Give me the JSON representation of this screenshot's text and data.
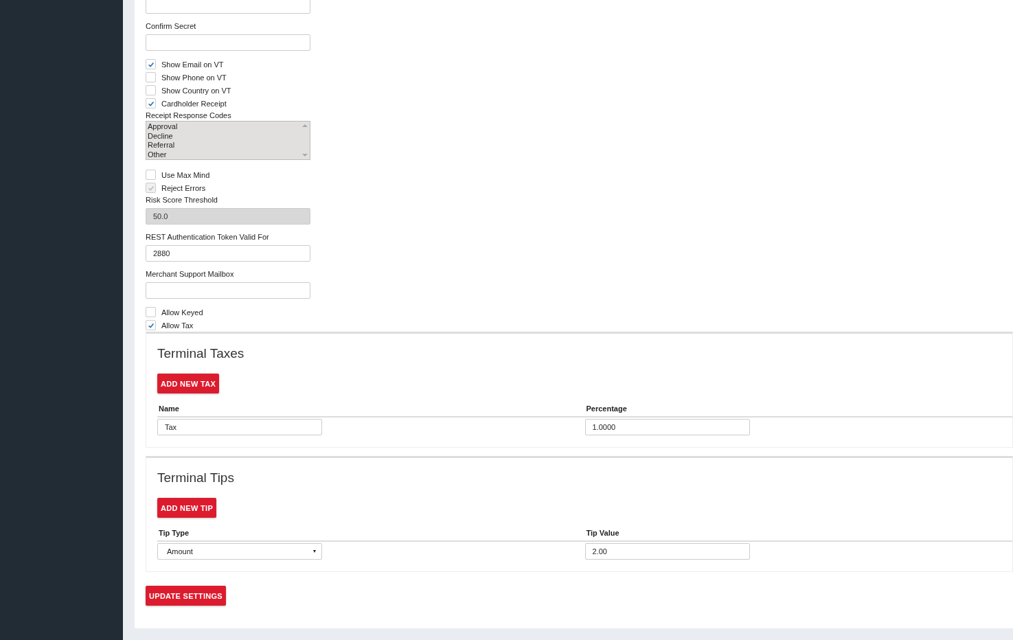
{
  "settings": [
    {
      "kind": "field",
      "disabled": false
    },
    {
      "kind": "field",
      "label": "Confirm Secret",
      "disabled": false
    },
    {
      "kind": "checkbox",
      "label": "Show Email on VT",
      "checked": true,
      "disabled": false
    },
    {
      "kind": "checkbox",
      "label": "Show Phone on VT",
      "checked": false,
      "disabled": false
    },
    {
      "kind": "checkbox",
      "label": "Show Country on VT",
      "checked": false,
      "disabled": false
    },
    {
      "kind": "checkbox",
      "label": "Cardholder Receipt",
      "checked": true,
      "disabled": false
    },
    {
      "kind": "listbox",
      "label": "Receipt Response Codes",
      "options": [
        "Approval",
        "Decline",
        "Referral",
        "Other"
      ]
    },
    {
      "kind": "checkbox",
      "label": "Use Max Mind",
      "checked": false,
      "disabled": false
    },
    {
      "kind": "checkbox",
      "label": "Reject Errors",
      "checked": true,
      "disabled": true
    },
    {
      "kind": "field",
      "label": "Risk Score Threshold",
      "value": "50.0",
      "disabled": true
    },
    {
      "kind": "field",
      "label": "REST Authentication Token Valid For",
      "value": "2880",
      "disabled": false
    },
    {
      "kind": "field",
      "label": "Merchant Support Mailbox",
      "disabled": false
    },
    {
      "kind": "checkbox",
      "label": "Allow Keyed",
      "checked": false,
      "disabled": false
    },
    {
      "kind": "checkbox",
      "label": "Allow Tax",
      "checked": true,
      "disabled": false
    }
  ],
  "panels": [
    {
      "title": "Terminal Taxes",
      "button": "ADD NEW TAX",
      "columns": [
        "Name",
        "Percentage"
      ],
      "rows": [
        [
          {
            "kind": "input",
            "value": "Tax"
          },
          {
            "kind": "input",
            "value": "1.0000"
          }
        ]
      ]
    },
    {
      "title": "Terminal Tips",
      "button": "ADD NEW TIP",
      "columns": [
        "Tip Type",
        "Tip Value"
      ],
      "rows": [
        [
          {
            "kind": "select",
            "value": "Amount"
          },
          {
            "kind": "input",
            "value": "2.00"
          }
        ]
      ]
    }
  ],
  "submit": "UPDATE SETTINGS"
}
